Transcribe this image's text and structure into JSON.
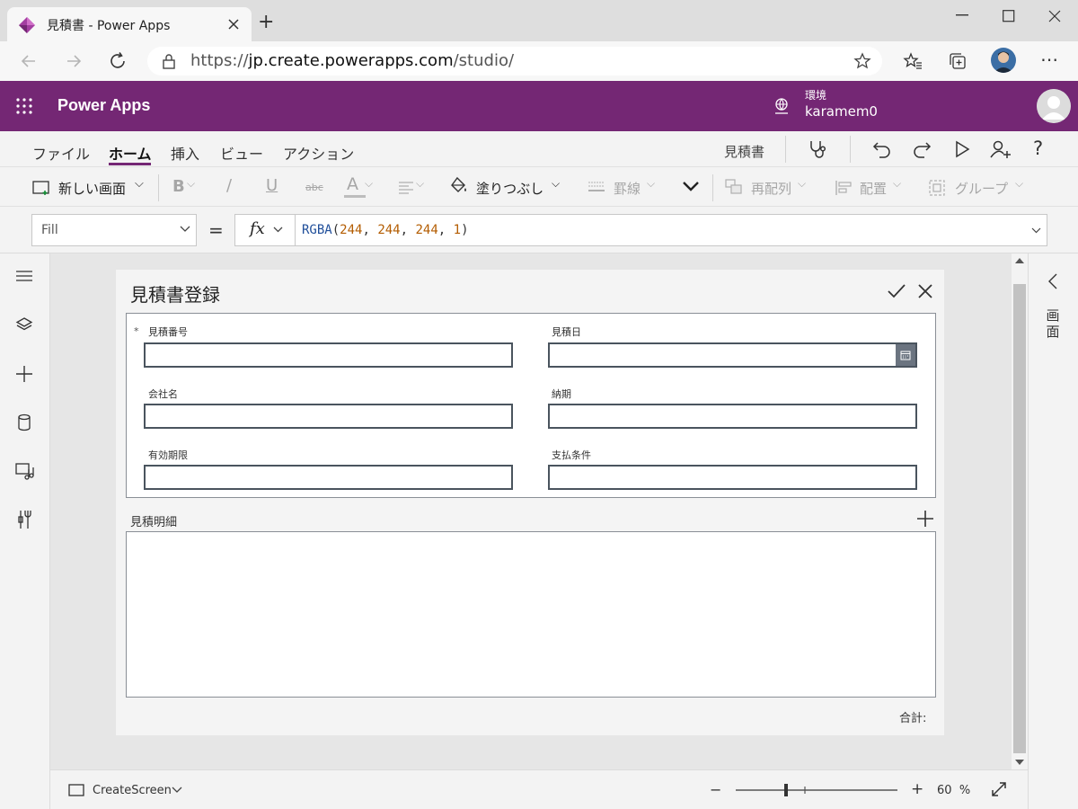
{
  "browser": {
    "tab_title": "見積書 - Power Apps",
    "url_prefix": "https://",
    "url_host": "jp.create.powerapps.com",
    "url_path": "/studio/",
    "new_tab_label": "+"
  },
  "app_header": {
    "app_name": "Power Apps",
    "env_label": "環境",
    "env_name": "karamem0"
  },
  "menu": {
    "tabs": [
      "ファイル",
      "ホーム",
      "挿入",
      "ビュー",
      "アクション"
    ],
    "active_tab": "ホーム",
    "app_title": "見積書"
  },
  "commands": {
    "new_screen": "新しい画面",
    "bold": "B",
    "italic": "/",
    "underline": "U",
    "strike": "abc",
    "font_color": "A",
    "fill": "塗りつぶし",
    "border": "罫線",
    "reorder": "再配列",
    "align": "配置",
    "group": "グループ"
  },
  "formula_bar": {
    "property": "Fill",
    "equals": "=",
    "fx": "fx",
    "formula_fn": "RGBA",
    "formula_args": [
      "244",
      "244",
      "244",
      "1"
    ]
  },
  "screen": {
    "title": "見積書登録",
    "fields": [
      {
        "label": "見積番号",
        "value": ""
      },
      {
        "label": "見積日",
        "value": ""
      },
      {
        "label": "会社名",
        "value": ""
      },
      {
        "label": "納期",
        "value": ""
      },
      {
        "label": "有効期限",
        "value": ""
      },
      {
        "label": "支払条件",
        "value": ""
      }
    ],
    "required_mark": "*",
    "details_label": "見積明細",
    "total_label": "合計:"
  },
  "right_panel": {
    "label": "画面"
  },
  "bottom_bar": {
    "screen_name": "CreateScreen",
    "zoom_minus": "−",
    "zoom_plus": "+",
    "zoom_value": "60",
    "zoom_unit": "%",
    "zoom_level": 0.6
  },
  "colors": {
    "header": "#742774",
    "screen_fill": "#f4f4f4"
  }
}
